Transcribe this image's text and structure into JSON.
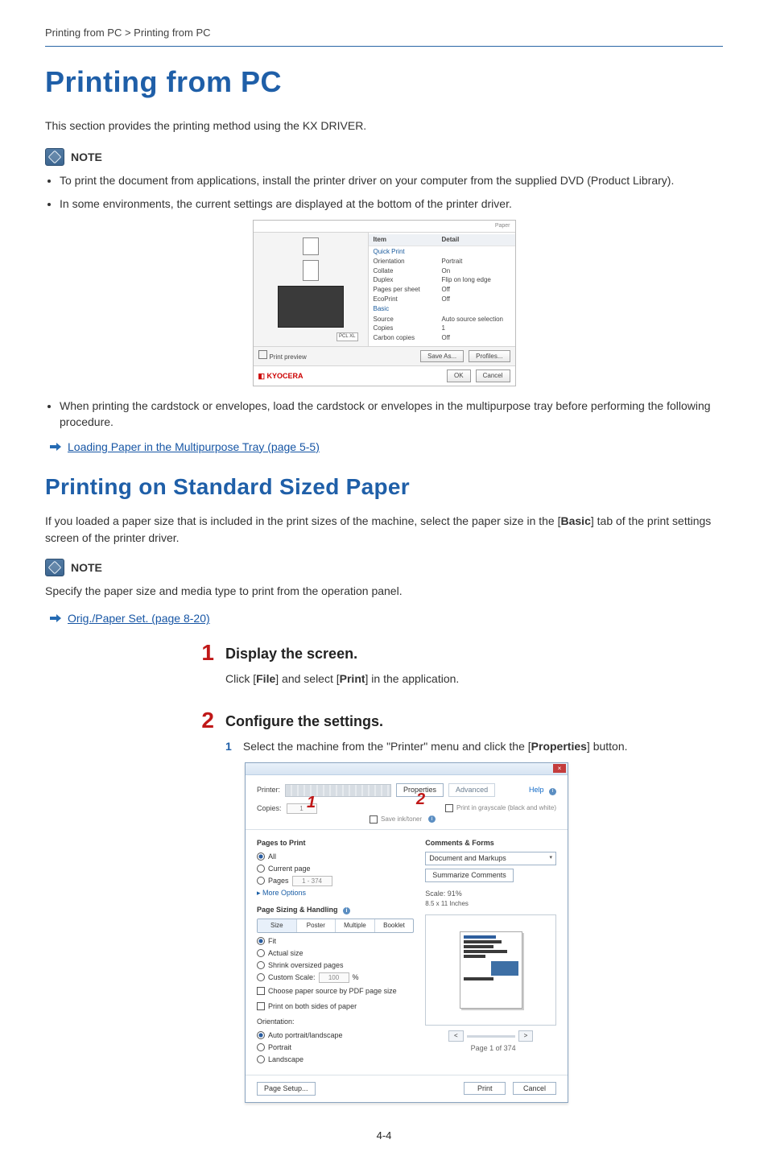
{
  "breadcrumb": "Printing from PC > Printing from PC",
  "title": "Printing from PC",
  "intro": "This section provides the printing method using the KX DRIVER.",
  "note_label": "NOTE",
  "notes_a": [
    "To print the document from applications, install the printer driver on your computer from the supplied DVD (Product Library).",
    "In some environments, the current settings are displayed at the bottom of the printer driver."
  ],
  "panel": {
    "top_tab": "Paper",
    "header_item": "Item",
    "header_detail": "Detail",
    "groups": [
      {
        "name": "Quick Print",
        "rows": [
          {
            "k": "Orientation",
            "v": "Portrait"
          },
          {
            "k": "Collate",
            "v": "On"
          },
          {
            "k": "Duplex",
            "v": "Flip on long edge"
          },
          {
            "k": "Pages per sheet",
            "v": "Off"
          },
          {
            "k": "EcoPrint",
            "v": "Off"
          }
        ]
      },
      {
        "name": "Basic",
        "rows": [
          {
            "k": "Source",
            "v": "Auto source selection"
          },
          {
            "k": "Copies",
            "v": "1"
          },
          {
            "k": "Carbon copies",
            "v": "Off"
          }
        ]
      }
    ],
    "pcl": "PCL XL",
    "print_preview": "Print preview",
    "save_as": "Save As...",
    "profiles": "Profiles...",
    "brand": "KYOCERA",
    "ok": "OK",
    "cancel": "Cancel"
  },
  "notes_b": [
    "When printing the cardstock or envelopes, load the cardstock or envelopes in the multipurpose tray before performing the following procedure."
  ],
  "xref1": "Loading Paper in the Multipurpose Tray (page 5-5)",
  "section2": "Printing on Standard Sized Paper",
  "section2_text_pre": "If you loaded a paper size that is included in the print sizes of the machine, select the paper size in the [",
  "section2_basic": "Basic",
  "section2_text_post": "] tab of the print settings screen of the printer driver.",
  "note2_text": "Specify the paper size and media type to print from the operation panel.",
  "xref2": "Orig./Paper Set. (page 8-20)",
  "steps": {
    "s1": {
      "num": "1",
      "title": "Display the screen.",
      "text_pre": "Click [",
      "file": "File",
      "text_mid": "] and select [",
      "print": "Print",
      "text_post": "] in the application."
    },
    "s2": {
      "num": "2",
      "title": "Configure the settings.",
      "sub_num": "1",
      "sub_text_pre": "Select the machine from the \"Printer\" menu and click the [",
      "properties": "Properties",
      "sub_text_post": "] button."
    }
  },
  "dialog": {
    "printer_label": "Printer:",
    "properties": "Properties",
    "advanced": "Advanced",
    "help": "Help",
    "grayscale": "Save ink/toner",
    "grayscale2": "Print in grayscale (black and white)",
    "copies_label": "Copies:",
    "copies_val": "1",
    "pages_to_print": "Pages to Print",
    "all": "All",
    "current_page": "Current page",
    "pages": "Pages",
    "pages_range": "1 - 374",
    "more_options": "More Options",
    "sizing": "Page Sizing & Handling",
    "size": "Size",
    "poster": "Poster",
    "multiple": "Multiple",
    "booklet": "Booklet",
    "fit": "Fit",
    "actual": "Actual size",
    "shrink": "Shrink oversized pages",
    "custom_scale": "Custom Scale:",
    "custom_scale_val": "100",
    "percent": "%",
    "choose_paper": "Choose paper source by PDF page size",
    "both_sides": "Print on both sides of paper",
    "orientation": "Orientation:",
    "auto_pl": "Auto portrait/landscape",
    "portrait": "Portrait",
    "landscape": "Landscape",
    "comments": "Comments & Forms",
    "doc_markups": "Document and Markups",
    "summarize": "Summarize Comments",
    "scale": "Scale:  91%",
    "paper_dim": "8.5 x 11 Inches",
    "page_of": "Page 1 of 374",
    "nav_prev": "<",
    "nav_next": ">",
    "page_setup": "Page Setup...",
    "print_btn": "Print",
    "cancel_btn": "Cancel",
    "info": "i"
  },
  "footer_page": "4-4"
}
